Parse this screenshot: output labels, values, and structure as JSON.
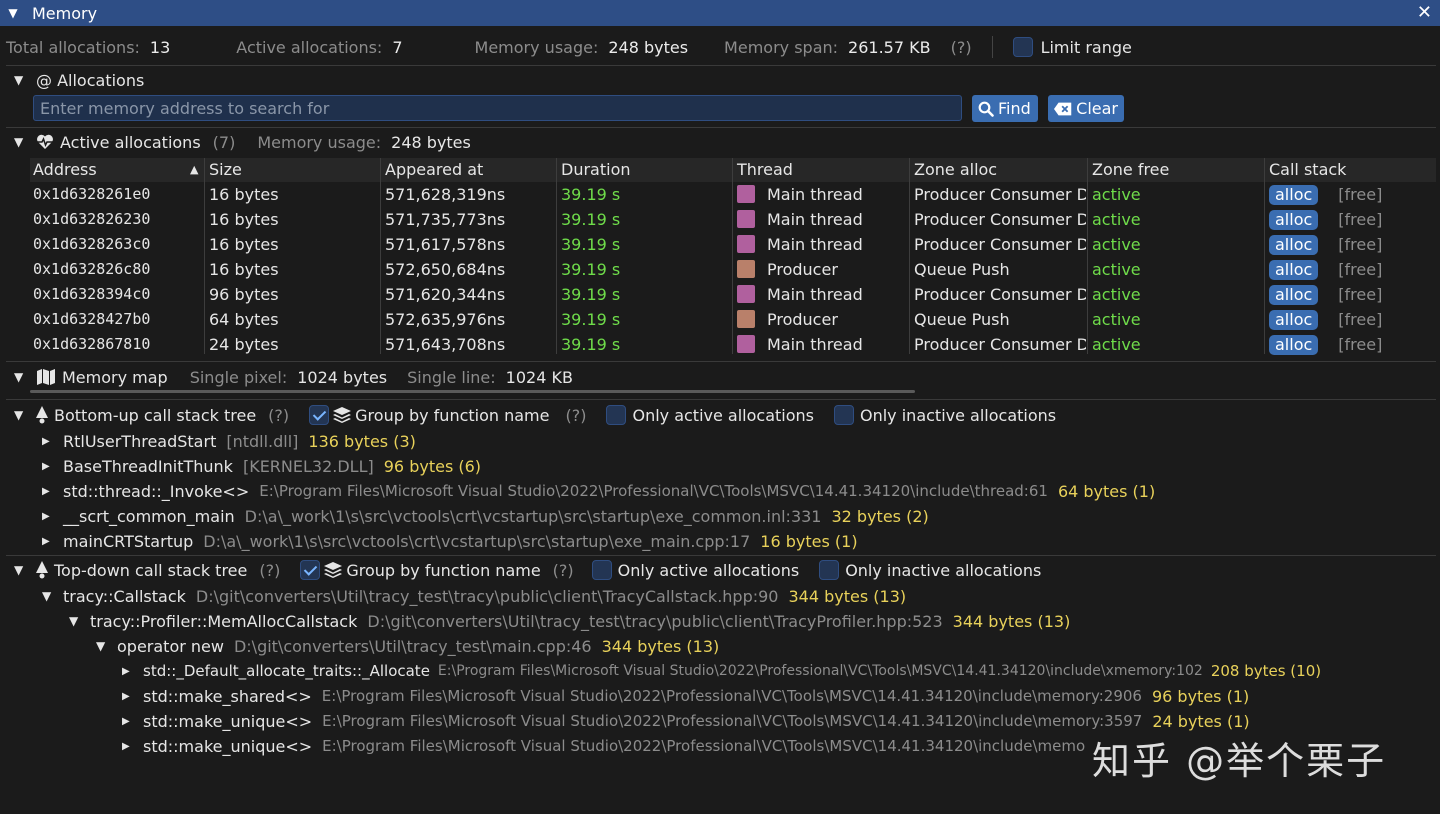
{
  "window": {
    "title": "Memory",
    "close_glyph": "✕"
  },
  "summary": {
    "total_label": "Total allocations:",
    "total_value": "13",
    "active_label": "Active allocations:",
    "active_value": "7",
    "usage_label": "Memory usage:",
    "usage_value": "248 bytes",
    "span_label": "Memory span:",
    "span_value": "261.57 KB",
    "help": "(?)",
    "limit_range_label": "Limit range"
  },
  "allocations": {
    "header": "@ Allocations",
    "search_placeholder": "Enter memory address to search for",
    "find_label": "Find",
    "clear_label": "Clear"
  },
  "active": {
    "header": "Active allocations",
    "count": "(7)",
    "usage_label": "Memory usage:",
    "usage_value": "248 bytes",
    "columns": [
      "Address",
      "Size",
      "Appeared at",
      "Duration",
      "Thread",
      "Zone alloc",
      "Zone free",
      "Call stack"
    ],
    "rows": [
      {
        "address": "0x1d6328261e0",
        "size": "16 bytes",
        "appeared": "571,628,319ns",
        "duration": "39.19 s",
        "thread": "Main thread",
        "thread_color": "#b0609e",
        "zone_alloc": "Producer Consumer D",
        "zone_free": "active",
        "alloc": "alloc",
        "free": "[free]"
      },
      {
        "address": "0x1d632826230",
        "size": "16 bytes",
        "appeared": "571,735,773ns",
        "duration": "39.19 s",
        "thread": "Main thread",
        "thread_color": "#b0609e",
        "zone_alloc": "Producer Consumer D",
        "zone_free": "active",
        "alloc": "alloc",
        "free": "[free]"
      },
      {
        "address": "0x1d6328263c0",
        "size": "16 bytes",
        "appeared": "571,617,578ns",
        "duration": "39.19 s",
        "thread": "Main thread",
        "thread_color": "#b0609e",
        "zone_alloc": "Producer Consumer D",
        "zone_free": "active",
        "alloc": "alloc",
        "free": "[free]"
      },
      {
        "address": "0x1d632826c80",
        "size": "16 bytes",
        "appeared": "572,650,684ns",
        "duration": "39.19 s",
        "thread": "Producer",
        "thread_color": "#b9806a",
        "zone_alloc": "Queue Push",
        "zone_free": "active",
        "alloc": "alloc",
        "free": "[free]"
      },
      {
        "address": "0x1d6328394c0",
        "size": "96 bytes",
        "appeared": "571,620,344ns",
        "duration": "39.19 s",
        "thread": "Main thread",
        "thread_color": "#b0609e",
        "zone_alloc": "Producer Consumer D",
        "zone_free": "active",
        "alloc": "alloc",
        "free": "[free]"
      },
      {
        "address": "0x1d6328427b0",
        "size": "64 bytes",
        "appeared": "572,635,976ns",
        "duration": "39.19 s",
        "thread": "Producer",
        "thread_color": "#b9806a",
        "zone_alloc": "Queue Push",
        "zone_free": "active",
        "alloc": "alloc",
        "free": "[free]"
      },
      {
        "address": "0x1d632867810",
        "size": "24 bytes",
        "appeared": "571,643,708ns",
        "duration": "39.19 s",
        "thread": "Main thread",
        "thread_color": "#b0609e",
        "zone_alloc": "Producer Consumer D",
        "zone_free": "active",
        "alloc": "alloc",
        "free": "[free]"
      }
    ]
  },
  "memory_map": {
    "header": "Memory map",
    "pixel_label": "Single pixel:",
    "pixel_value": "1024 bytes",
    "line_label": "Single line:",
    "line_value": "1024 KB"
  },
  "bottom_up": {
    "header": "Bottom-up call stack tree",
    "help": "(?)",
    "group_label": "Group by function name",
    "group_help": "(?)",
    "only_active": "Only active allocations",
    "only_inactive": "Only inactive allocations",
    "items": [
      {
        "name": "RtlUserThreadStart",
        "location": "[ntdll.dll]",
        "bytes": "136 bytes (3)"
      },
      {
        "name": "BaseThreadInitThunk",
        "location": "[KERNEL32.DLL]",
        "bytes": "96 bytes (6)"
      },
      {
        "name": "std::thread::_Invoke<>",
        "location": "E:\\Program Files\\Microsoft Visual Studio\\2022\\Professional\\VC\\Tools\\MSVC\\14.41.34120\\include\\thread:61",
        "bytes": "64 bytes (1)"
      },
      {
        "name": "__scrt_common_main",
        "location": "D:\\a\\_work\\1\\s\\src\\vctools\\crt\\vcstartup\\src\\startup\\exe_common.inl:331",
        "bytes": "32 bytes (2)"
      },
      {
        "name": "mainCRTStartup",
        "location": "D:\\a\\_work\\1\\s\\src\\vctools\\crt\\vcstartup\\src\\startup\\exe_main.cpp:17",
        "bytes": "16 bytes (1)"
      }
    ]
  },
  "top_down": {
    "header": "Top-down call stack tree",
    "help": "(?)",
    "group_label": "Group by function name",
    "group_help": "(?)",
    "only_active": "Only active allocations",
    "only_inactive": "Only inactive allocations",
    "items": [
      {
        "name": "tracy::Callstack",
        "location": "D:\\git\\converters\\Util\\tracy_test\\tracy\\public\\client\\TracyCallstack.hpp:90",
        "bytes": "344 bytes (13)"
      },
      {
        "name": "tracy::Profiler::MemAllocCallstack",
        "location": "D:\\git\\converters\\Util\\tracy_test\\tracy\\public\\client\\TracyProfiler.hpp:523",
        "bytes": "344 bytes (13)"
      },
      {
        "name": "operator new",
        "location": "D:\\git\\converters\\Util\\tracy_test\\main.cpp:46",
        "bytes": "344 bytes (13)"
      },
      {
        "name": "std::_Default_allocate_traits::_Allocate",
        "location": "E:\\Program Files\\Microsoft Visual Studio\\2022\\Professional\\VC\\Tools\\MSVC\\14.41.34120\\include\\xmemory:102",
        "bytes": "208 bytes (10)"
      },
      {
        "name": "std::make_shared<>",
        "location": "E:\\Program Files\\Microsoft Visual Studio\\2022\\Professional\\VC\\Tools\\MSVC\\14.41.34120\\include\\memory:2906",
        "bytes": "96 bytes (1)"
      },
      {
        "name": "std::make_unique<>",
        "location": "E:\\Program Files\\Microsoft Visual Studio\\2022\\Professional\\VC\\Tools\\MSVC\\14.41.34120\\include\\memory:3597",
        "bytes": "24 bytes (1)"
      },
      {
        "name": "std::make_unique<>",
        "location": "E:\\Program Files\\Microsoft Visual Studio\\2022\\Professional\\VC\\Tools\\MSVC\\14.41.34120\\include\\memo",
        "bytes": ""
      }
    ]
  },
  "watermark": "知乎 @举个栗子"
}
